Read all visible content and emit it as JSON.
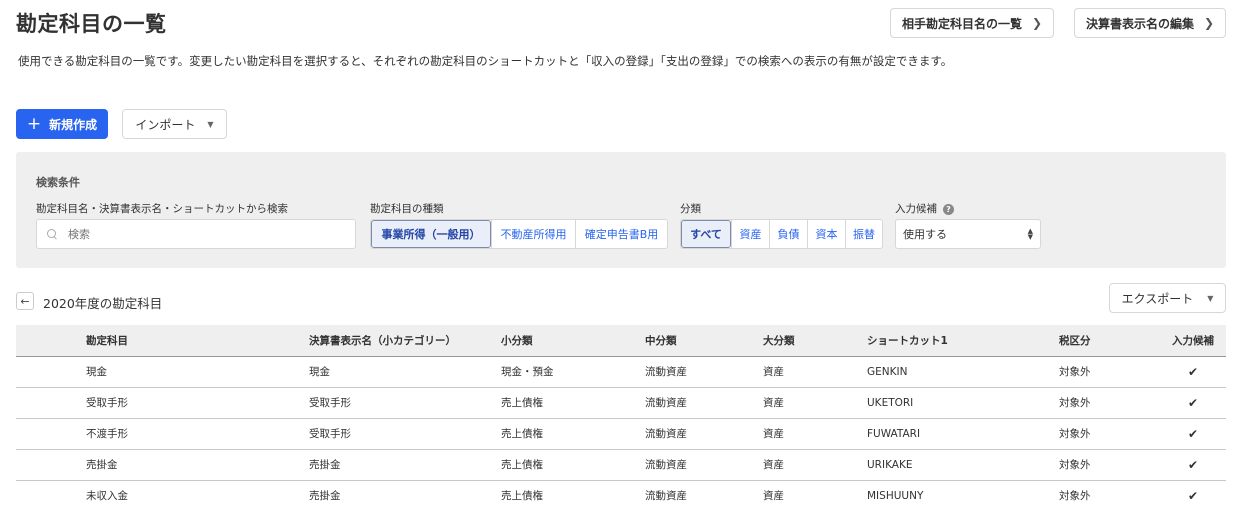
{
  "page": {
    "title": "勘定科目の一覧",
    "description": "使用できる勘定科目の一覧です。変更したい勘定科目を選択すると、それぞれの勘定科目のショートカットと「収入の登録」「支出の登録」での検索への表示の有無が設定できます。"
  },
  "header_buttons": {
    "partner_list": "相手勘定科目名の一覧",
    "statement_edit": "決算書表示名の編集"
  },
  "actions": {
    "new_label": "新規作成",
    "import_label": "インポート",
    "export_label": "エクスポート"
  },
  "search": {
    "heading": "検索条件",
    "text_label": "勘定科目名・決算書表示名・ショートカットから検索",
    "placeholder": "検索",
    "type_label": "勘定科目の種類",
    "type_options": [
      "事業所得（一般用）",
      "不動産所得用",
      "確定申告書B用"
    ],
    "type_selected": "事業所得（一般用）",
    "category_label": "分類",
    "category_options": [
      "すべて",
      "資産",
      "負債",
      "資本",
      "振替"
    ],
    "category_selected": "すべて",
    "candidate_label": "入力候補",
    "candidate_value": "使用する"
  },
  "list": {
    "year_title": "2020年度の勘定科目",
    "columns": [
      "勘定科目",
      "決算書表示名（小カテゴリー）",
      "小分類",
      "中分類",
      "大分類",
      "ショートカット1",
      "税区分",
      "入力候補"
    ],
    "rows": [
      {
        "account": "現金",
        "display": "現金",
        "small": "現金・預金",
        "mid": "流動資産",
        "large": "資産",
        "shortcut": "GENKIN",
        "tax": "対象外",
        "candidate": "✔"
      },
      {
        "account": "受取手形",
        "display": "受取手形",
        "small": "売上債権",
        "mid": "流動資産",
        "large": "資産",
        "shortcut": "UKETORI",
        "tax": "対象外",
        "candidate": "✔"
      },
      {
        "account": "不渡手形",
        "display": "受取手形",
        "small": "売上債権",
        "mid": "流動資産",
        "large": "資産",
        "shortcut": "FUWATARI",
        "tax": "対象外",
        "candidate": "✔"
      },
      {
        "account": "売掛金",
        "display": "売掛金",
        "small": "売上債権",
        "mid": "流動資産",
        "large": "資産",
        "shortcut": "URIKAKE",
        "tax": "対象外",
        "candidate": "✔"
      },
      {
        "account": "未収入金",
        "display": "売掛金",
        "small": "売上債権",
        "mid": "流動資産",
        "large": "資産",
        "shortcut": "MISHUUNY",
        "tax": "対象外",
        "candidate": "✔"
      }
    ]
  },
  "colors": {
    "primary": "#2864f0",
    "panel_bg": "#efefef",
    "active_segment_bg": "#e9eef8"
  }
}
